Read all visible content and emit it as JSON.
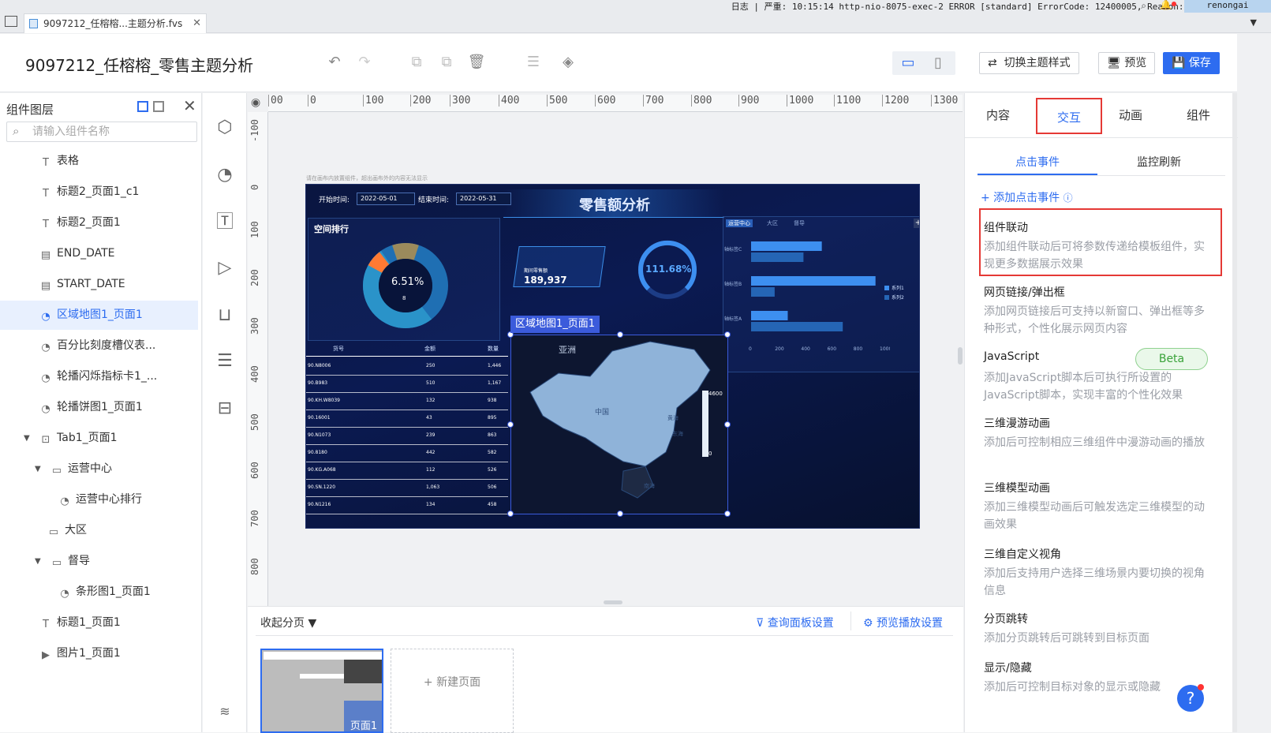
{
  "app": {
    "status_line": "日志 | 严重: 10:15:14 http-nio-8075-exec-2 ERROR [standard] ErrorCode: 12400005, Reason: 模板未操...",
    "user": "renongai",
    "file_tab": "9097212_任榕榕...主题分析.fvs",
    "doc_title": "9097212_任榕榕_零售主题分析"
  },
  "header": {
    "switch_theme": "切换主题样式",
    "preview": "预览",
    "save": "保存"
  },
  "left_panel": {
    "title": "组件图层",
    "search_placeholder": "请输入组件名称",
    "items": [
      {
        "label": "表格",
        "icon": "T"
      },
      {
        "label": "标题2_页面1_c1",
        "icon": "T"
      },
      {
        "label": "标题2_页面1",
        "icon": "T"
      },
      {
        "label": "END_DATE",
        "icon": "▤"
      },
      {
        "label": "START_DATE",
        "icon": "▤"
      },
      {
        "label": "区域地图1_页面1",
        "icon": "◔"
      },
      {
        "label": "百分比刻度槽仪表...",
        "icon": "◔"
      },
      {
        "label": "轮播闪烁指标卡1_...",
        "icon": "◔"
      },
      {
        "label": "轮播饼图1_页面1",
        "icon": "◔"
      },
      {
        "label": "Tab1_页面1",
        "icon": "⊡"
      },
      {
        "label": "运营中心",
        "icon": "▭"
      },
      {
        "label": "运营中心排行",
        "icon": "◔"
      },
      {
        "label": "大区",
        "icon": "▭"
      },
      {
        "label": "督导",
        "icon": "▭"
      },
      {
        "label": "条形图1_页面1",
        "icon": "◔"
      },
      {
        "label": "标题1_页面1",
        "icon": "T"
      },
      {
        "label": "图片1_页面1",
        "icon": "▶"
      }
    ]
  },
  "ruler": {
    "top": [
      "00",
      "0",
      "100",
      "200",
      "300",
      "400",
      "500",
      "600",
      "700",
      "800",
      "900",
      "1000",
      "1100",
      "1200",
      "1300"
    ],
    "left": [
      "-100",
      "0",
      "100",
      "200",
      "300",
      "400",
      "500",
      "600",
      "700",
      "800"
    ]
  },
  "dashboard": {
    "hint": "请在画布内放置组件，超出画布外的内容无法显示",
    "title": "零售额分析",
    "start_label": "开始时间:",
    "start_value": "2022-05-01",
    "end_label": "结束时间:",
    "end_value": "2022-05-31",
    "space_rank": "空间排行",
    "donut_pct": "6.51%",
    "donut_sub": "8",
    "kpi_label": "期间零售额",
    "kpi_value": "189,937",
    "gauge_value": "111.68%",
    "tabs": [
      "运营中心",
      "大区",
      "督导"
    ],
    "bar_labels": [
      "轴标签C",
      "轴标签B",
      "轴标签A"
    ],
    "bar_axis": [
      "0",
      "200",
      "400",
      "600",
      "800",
      "1000"
    ],
    "legend": [
      "系列1",
      "系列2"
    ],
    "series1": [
      540,
      950,
      280
    ],
    "series2": [
      400,
      180,
      700
    ],
    "table_headers": [
      "货号",
      "金额",
      "数量"
    ],
    "table_rows": [
      [
        "90.N8006",
        "250",
        "1,446"
      ],
      [
        "90.B983",
        "510",
        "1,167"
      ],
      [
        "90.KH.W8039",
        "132",
        "938"
      ],
      [
        "90.16001",
        "43",
        "895"
      ],
      [
        "90.N1073",
        "239",
        "863"
      ],
      [
        "90.8180",
        "442",
        "582"
      ],
      [
        "90.KG.A068",
        "112",
        "526"
      ],
      [
        "90.SN.1220",
        "1,063",
        "506"
      ],
      [
        "90.N1216",
        "134",
        "458"
      ]
    ],
    "map_selected": "区域地图1_页面1",
    "map_region": "亚洲",
    "map_china": "中国",
    "map_labels": [
      "黄海",
      "东海",
      "南海"
    ],
    "scale_max": "4600",
    "scale_min": "0"
  },
  "bottom": {
    "collapse": "收起分页",
    "query_panel": "查询面板设置",
    "preview_play": "预览播放设置",
    "page1": "页面1",
    "new_page": "+ 新建页面"
  },
  "right_panel": {
    "tabs": [
      "内容",
      "交互",
      "动画",
      "组件"
    ],
    "active_tab": "交互",
    "subtabs": [
      "点击事件",
      "监控刷新"
    ],
    "add_event": "+ 添加点击事件",
    "beta": "Beta",
    "events": [
      {
        "title": "组件联动",
        "desc": "添加组件联动后可将参数传递给模板组件，实现更多数据展示效果"
      },
      {
        "title": "网页链接/弹出框",
        "desc": "添加网页链接后可支持以新窗口、弹出框等多种形式，个性化展示网页内容"
      },
      {
        "title": "JavaScript",
        "desc": "添加JavaScript脚本后可执行所设置的JavaScript脚本，实现丰富的个性化效果"
      },
      {
        "title": "三维漫游动画",
        "desc": "添加后可控制相应三维组件中漫游动画的播放"
      },
      {
        "title": "三维模型动画",
        "desc": "添加三维模型动画后可触发选定三维模型的动画效果"
      },
      {
        "title": "三维自定义视角",
        "desc": "添加后支持用户选择三维场景内要切换的视角信息"
      },
      {
        "title": "分页跳转",
        "desc": "添加分页跳转后可跳转到目标页面"
      },
      {
        "title": "显示/隐藏",
        "desc": "添加后可控制目标对象的显示或隐藏"
      }
    ]
  },
  "colors": {
    "accent": "#2d6cf0",
    "highlight_red": "#e53935",
    "dash_bg": "#0a1640"
  }
}
